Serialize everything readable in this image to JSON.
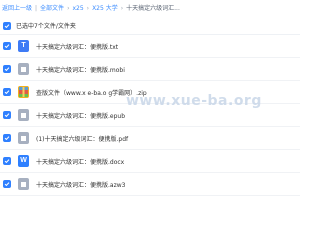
{
  "breadcrumb": {
    "items": [
      "返回上一级",
      "全部文件",
      "x25",
      "X25 大学",
      "十天搞定六级词汇..."
    ]
  },
  "selection": {
    "summary": "已选中7个文件/文件夹"
  },
  "files": [
    {
      "name": "十天搞定六级词汇：便携版.txt",
      "icon": "txt-file-icon",
      "icon_color": "#3e7bf5",
      "checked": true
    },
    {
      "name": "十天搞定六级词汇：便携版.mobi",
      "icon": "generic-file-icon",
      "icon_color": "#a7b0c0",
      "checked": true
    },
    {
      "name": "查版文件（www.x e-ba.o g学霸网）.zip",
      "icon": "zip-file-icon",
      "icon_color": "#f2b01e",
      "checked": true
    },
    {
      "name": "十天搞定六级词汇：便携版.epub",
      "icon": "generic-file-icon",
      "icon_color": "#a7b0c0",
      "checked": true
    },
    {
      "name": "(1)十天搞定六级词汇：便携版.pdf",
      "icon": "pdf-file-icon",
      "icon_color": "#a7b0c0",
      "checked": true
    },
    {
      "name": "十天搞定六级词汇：便携版.docx",
      "icon": "word-file-icon",
      "icon_color": "#2f80ff",
      "checked": true
    },
    {
      "name": "十天搞定六级词汇：便携版.azw3",
      "icon": "generic-file-icon",
      "icon_color": "#a7b0c0",
      "checked": true
    }
  ],
  "watermark": "www.xue-ba.org",
  "colors": {
    "accent": "#2f80ff",
    "link": "#3b8cff",
    "text": "#333333"
  }
}
